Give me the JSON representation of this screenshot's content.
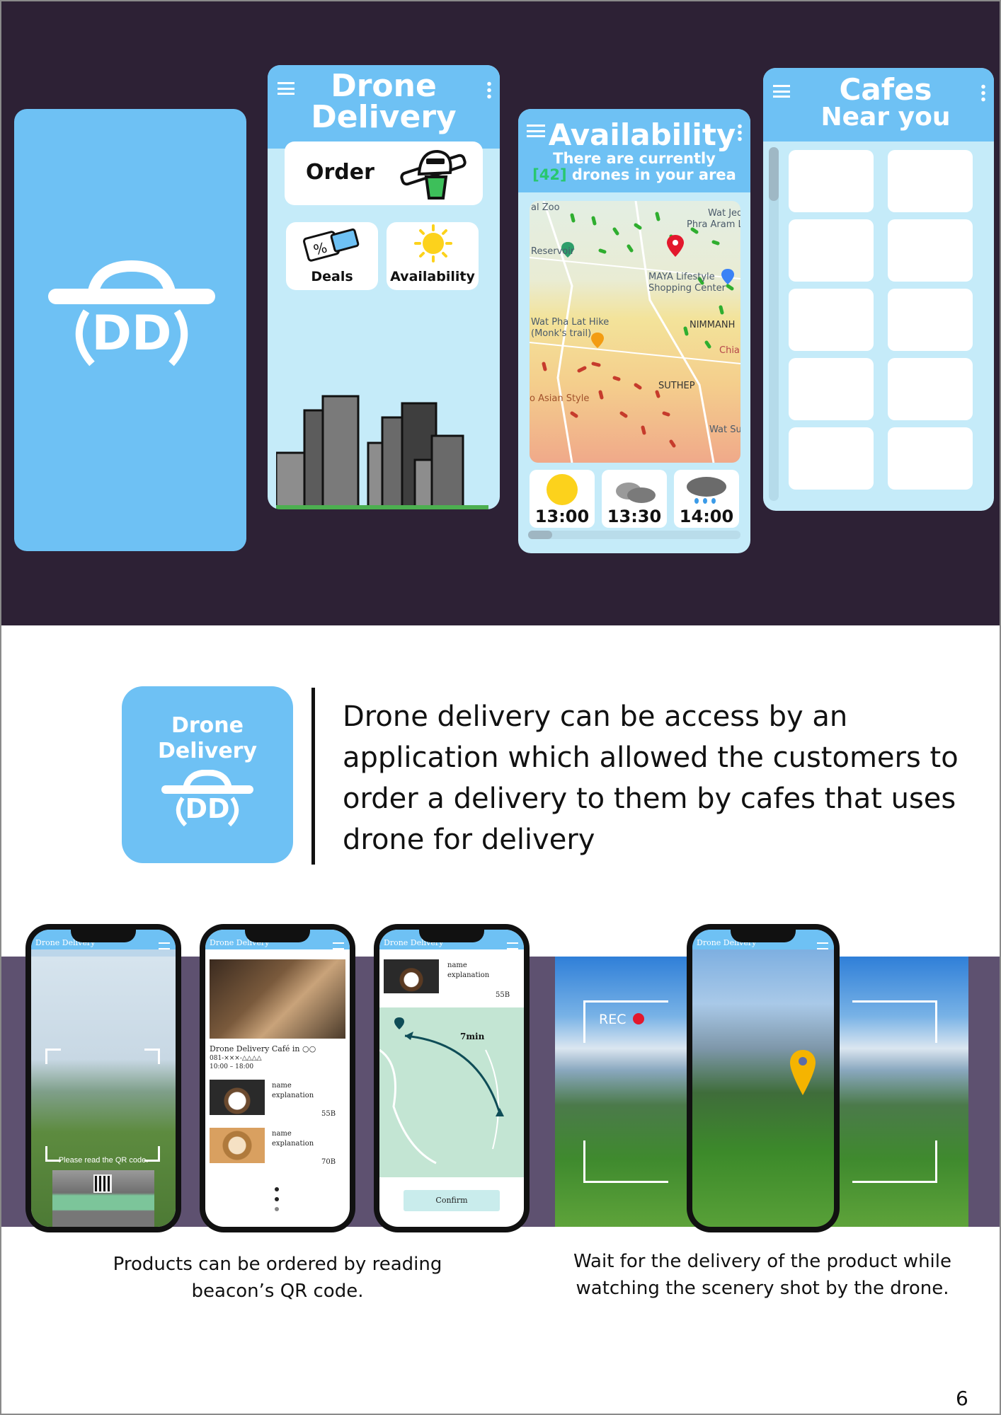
{
  "top_screens": {
    "splash": {
      "logo_letters": "DD"
    },
    "home": {
      "title_line1": "Drone",
      "title_line2": "Delivery",
      "order_label": "Order",
      "deals_label": "Deals",
      "availability_label": "Availability"
    },
    "availability": {
      "title": "Availability",
      "subtitle_line1": "There are currently",
      "drone_count": "[42]",
      "subtitle_line2_rest": " drones in your area",
      "map_labels": [
        "al Zoo",
        "Wat Jed",
        "Phra Aram L",
        "Reservoir",
        "MAYA Lifestyle",
        "Shopping Center",
        "Wat Pha Lat Hike",
        "(Monk's trail)",
        "NIMMANH",
        "Chian",
        "SUTHEP",
        "o Asian Style",
        "Wat Su"
      ],
      "weather": [
        {
          "time": "13:00",
          "icon": "sun-icon"
        },
        {
          "time": "13:30",
          "icon": "cloud-icon"
        },
        {
          "time": "14:00",
          "icon": "rain-cloud-icon"
        }
      ]
    },
    "cafes": {
      "title_line1": "Cafes",
      "title_line2": "Near you"
    }
  },
  "intro": {
    "logo_line1": "Drone",
    "logo_line2": "Delivery",
    "logo_letters": "DD",
    "text": "Drone delivery can be access by an application which allowed the customers to order a delivery to them by cafes that uses drone for delivery"
  },
  "phones": {
    "app_title": "Drone Delivery",
    "qr_hint": "Please read the QR code.",
    "cafe_name": "Drone Delivery Café in ○○",
    "cafe_phone": "081-×××-△△△△",
    "cafe_hours": "10:00 – 18:00",
    "item1_name": "name",
    "item1_expl": "explanation",
    "item1_price": "55B",
    "item2_name": "name",
    "item2_expl": "explanation",
    "item2_price": "70B",
    "route_time": "7min",
    "confirm_label": "Confirm",
    "rec_label": "REC"
  },
  "captions": {
    "left": "Products can be ordered by reading beacon’s QR code.",
    "right": "Wait for the delivery of the product while watching the scenery shot by the drone."
  },
  "page_number": "6",
  "colors": {
    "accent": "#6ec1f4",
    "dark_band": "#2d2135",
    "purple_band": "#5e5170",
    "drone_count": "#28c76f"
  }
}
